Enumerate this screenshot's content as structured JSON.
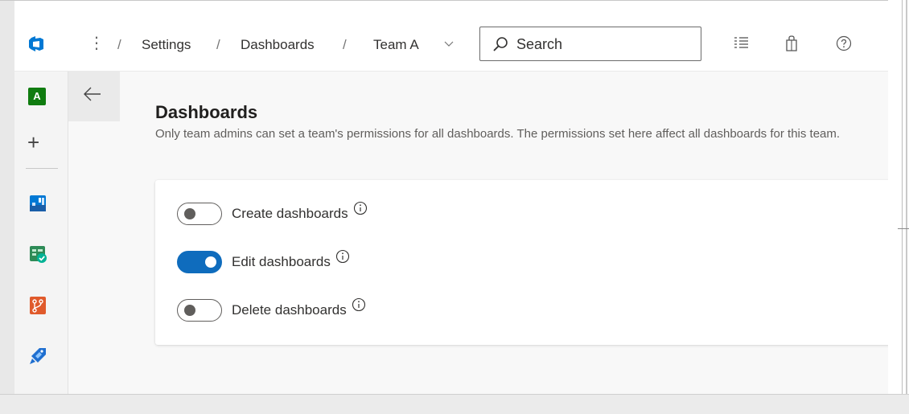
{
  "header": {
    "more_label": "⋮",
    "separator": "/",
    "breadcrumb": [
      "Settings",
      "Dashboards",
      "Team A"
    ],
    "search": {
      "placeholder": "Search",
      "value": ""
    },
    "icons": [
      "checklist-icon",
      "shopping-bag-icon",
      "help-icon"
    ]
  },
  "sidebar": {
    "avatar_letter": "A",
    "add_label": "+",
    "services": [
      "boards-icon",
      "test-plans-icon",
      "repos-icon",
      "pipelines-icon"
    ]
  },
  "page": {
    "title": "Dashboards",
    "description": "Only team admins can set a team's permissions for all dashboards. The permissions set here affect all dashboards for this team."
  },
  "permissions": [
    {
      "label": "Create dashboards",
      "enabled": false
    },
    {
      "label": "Edit dashboards",
      "enabled": true
    },
    {
      "label": "Delete dashboards",
      "enabled": false
    }
  ],
  "colors": {
    "accent": "#0f6cbd",
    "avatar": "#107c10",
    "toggle_off": "#605e5c"
  }
}
